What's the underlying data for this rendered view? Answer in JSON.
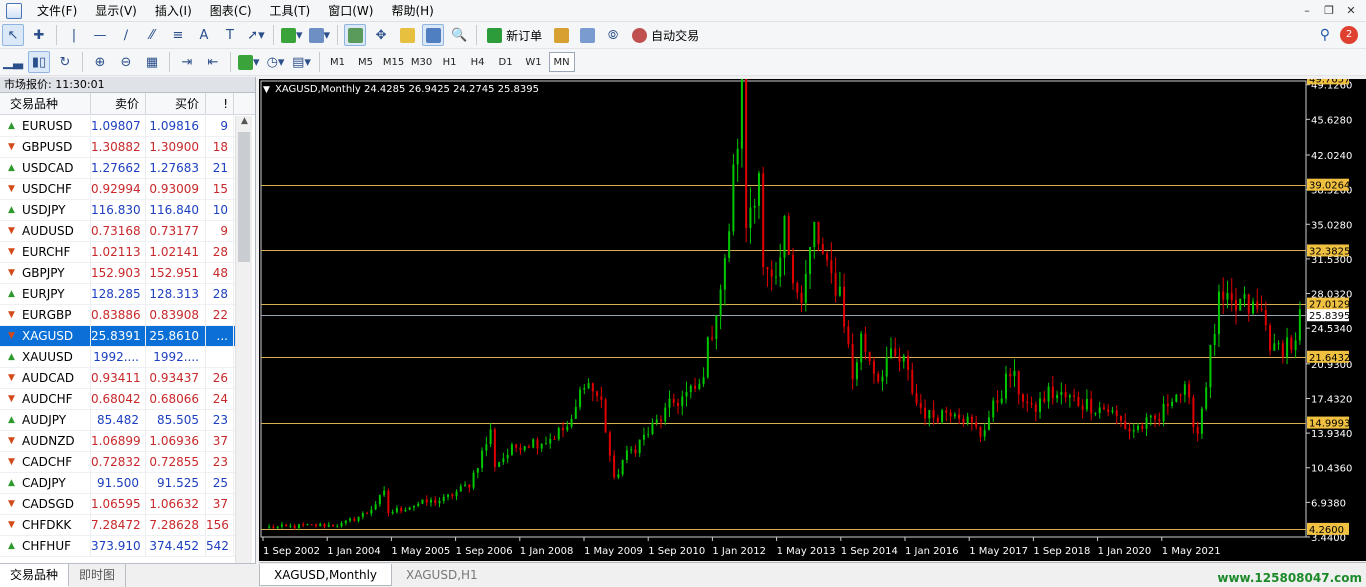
{
  "menu": [
    "文件(F)",
    "显示(V)",
    "插入(I)",
    "图表(C)",
    "工具(T)",
    "窗口(W)",
    "帮助(H)"
  ],
  "toolbar": {
    "new_order_label": "新订单",
    "auto_trade_label": "自动交易",
    "notification_count": "2"
  },
  "timeframes": [
    "M1",
    "M5",
    "M15",
    "M30",
    "H1",
    "H4",
    "D1",
    "W1",
    "MN"
  ],
  "active_timeframe": "MN",
  "market_watch": {
    "title": "市场报价: 11:30:01",
    "columns": {
      "symbol": "交易品种",
      "bid": "卖价",
      "ask": "买价",
      "spread": "!"
    },
    "rows": [
      {
        "symbol": "EURUSD",
        "bid": "1.09807",
        "ask": "1.09816",
        "spread": "9",
        "dir": "up"
      },
      {
        "symbol": "GBPUSD",
        "bid": "1.30882",
        "ask": "1.30900",
        "spread": "18",
        "dir": "down"
      },
      {
        "symbol": "USDCAD",
        "bid": "1.27662",
        "ask": "1.27683",
        "spread": "21",
        "dir": "up"
      },
      {
        "symbol": "USDCHF",
        "bid": "0.92994",
        "ask": "0.93009",
        "spread": "15",
        "dir": "down"
      },
      {
        "symbol": "USDJPY",
        "bid": "116.830",
        "ask": "116.840",
        "spread": "10",
        "dir": "up"
      },
      {
        "symbol": "AUDUSD",
        "bid": "0.73168",
        "ask": "0.73177",
        "spread": "9",
        "dir": "down"
      },
      {
        "symbol": "EURCHF",
        "bid": "1.02113",
        "ask": "1.02141",
        "spread": "28",
        "dir": "down"
      },
      {
        "symbol": "GBPJPY",
        "bid": "152.903",
        "ask": "152.951",
        "spread": "48",
        "dir": "down"
      },
      {
        "symbol": "EURJPY",
        "bid": "128.285",
        "ask": "128.313",
        "spread": "28",
        "dir": "up"
      },
      {
        "symbol": "EURGBP",
        "bid": "0.83886",
        "ask": "0.83908",
        "spread": "22",
        "dir": "down"
      },
      {
        "symbol": "XAGUSD",
        "bid": "25.8391",
        "ask": "25.8610",
        "spread": "...",
        "dir": "down",
        "selected": true
      },
      {
        "symbol": "XAUUSD",
        "bid": "1992....",
        "ask": "1992....",
        "spread": "",
        "dir": "up"
      },
      {
        "symbol": "AUDCAD",
        "bid": "0.93411",
        "ask": "0.93437",
        "spread": "26",
        "dir": "down"
      },
      {
        "symbol": "AUDCHF",
        "bid": "0.68042",
        "ask": "0.68066",
        "spread": "24",
        "dir": "down"
      },
      {
        "symbol": "AUDJPY",
        "bid": "85.482",
        "ask": "85.505",
        "spread": "23",
        "dir": "up"
      },
      {
        "symbol": "AUDNZD",
        "bid": "1.06899",
        "ask": "1.06936",
        "spread": "37",
        "dir": "down"
      },
      {
        "symbol": "CADCHF",
        "bid": "0.72832",
        "ask": "0.72855",
        "spread": "23",
        "dir": "down"
      },
      {
        "symbol": "CADJPY",
        "bid": "91.500",
        "ask": "91.525",
        "spread": "25",
        "dir": "up"
      },
      {
        "symbol": "CADSGD",
        "bid": "1.06595",
        "ask": "1.06632",
        "spread": "37",
        "dir": "down"
      },
      {
        "symbol": "CHFDKK",
        "bid": "7.28472",
        "ask": "7.28628",
        "spread": "156",
        "dir": "down"
      },
      {
        "symbol": "CHFHUF",
        "bid": "373.910",
        "ask": "374.452",
        "spread": "542",
        "dir": "up"
      }
    ],
    "tabs": [
      "交易品种",
      "即时图"
    ]
  },
  "chart_tabs": [
    "XAGUSD,Monthly",
    "XAGUSD,H1"
  ],
  "watermark": "www.125808047.com",
  "colors": {
    "bull": "#00c800",
    "bear": "#e00000",
    "level_line": "#d8b050",
    "price_line": "#9aa3b8",
    "chart_bg": "#000000",
    "axis_text": "#ffffff",
    "level_label_bg": "#f0c040"
  },
  "chart_data": {
    "type": "candlestick",
    "title": "XAGUSD,Monthly 24.4285 26.9425 24.2745 25.8395",
    "ylim": [
      3.44,
      49.5
    ],
    "yticks": [
      49.126,
      45.628,
      42.024,
      38.526,
      35.028,
      31.53,
      28.032,
      24.534,
      20.93,
      17.432,
      13.934,
      10.436,
      6.938,
      3.44
    ],
    "xtick_labels": [
      "1 Sep 2002",
      "1 Jan 2004",
      "1 May 2005",
      "1 Sep 2006",
      "1 Jan 2008",
      "1 May 2009",
      "1 Sep 2010",
      "1 Jan 2012",
      "1 May 2013",
      "1 Sep 2014",
      "1 Jan 2016",
      "1 May 2017",
      "1 Sep 2018",
      "1 Jan 2020",
      "1 May 2021"
    ],
    "x_start": "2002-01",
    "levels": [
      49.7657,
      39.0264,
      32.3825,
      27.0129,
      21.6432,
      14.9993,
      4.26
    ],
    "current_price": 25.8395,
    "anchors": [
      [
        "2002-01",
        4.4
      ],
      [
        "2002-12",
        4.6
      ],
      [
        "2003-06",
        4.7
      ],
      [
        "2003-12",
        5.9
      ],
      [
        "2004-04",
        7.8
      ],
      [
        "2004-05",
        5.9
      ],
      [
        "2004-12",
        6.8
      ],
      [
        "2005-06",
        7.2
      ],
      [
        "2005-12",
        8.8
      ],
      [
        "2006-05",
        14.0
      ],
      [
        "2006-06",
        10.8
      ],
      [
        "2006-12",
        12.9
      ],
      [
        "2007-06",
        13.2
      ],
      [
        "2007-12",
        14.8
      ],
      [
        "2008-03",
        19.5
      ],
      [
        "2008-07",
        17.0
      ],
      [
        "2008-10",
        9.0
      ],
      [
        "2008-12",
        11.2
      ],
      [
        "2009-06",
        14.0
      ],
      [
        "2009-12",
        17.0
      ],
      [
        "2010-06",
        18.5
      ],
      [
        "2010-12",
        30.6
      ],
      [
        "2011-04",
        48.4
      ],
      [
        "2011-05",
        35.0
      ],
      [
        "2011-08",
        41.0
      ],
      [
        "2011-09",
        30.0
      ],
      [
        "2011-12",
        28.2
      ],
      [
        "2012-02",
        34.5
      ],
      [
        "2012-06",
        27.0
      ],
      [
        "2012-09",
        34.6
      ],
      [
        "2012-12",
        30.0
      ],
      [
        "2013-03",
        28.5
      ],
      [
        "2013-06",
        19.5
      ],
      [
        "2013-08",
        23.5
      ],
      [
        "2013-12",
        19.5
      ],
      [
        "2014-02",
        21.5
      ],
      [
        "2014-06",
        21.0
      ],
      [
        "2014-09",
        17.0
      ],
      [
        "2014-12",
        15.6
      ],
      [
        "2015-06",
        16.5
      ],
      [
        "2015-12",
        13.8
      ],
      [
        "2016-07",
        20.0
      ],
      [
        "2016-12",
        16.0
      ],
      [
        "2017-04",
        18.0
      ],
      [
        "2017-12",
        17.0
      ],
      [
        "2018-06",
        16.3
      ],
      [
        "2018-11",
        14.2
      ],
      [
        "2019-06",
        15.3
      ],
      [
        "2019-09",
        18.0
      ],
      [
        "2019-12",
        18.0
      ],
      [
        "2020-03",
        14.0
      ],
      [
        "2020-07",
        24.5
      ],
      [
        "2020-08",
        26.9
      ],
      [
        "2020-12",
        26.4
      ],
      [
        "2021-01",
        27.0
      ],
      [
        "2021-06",
        26.0
      ],
      [
        "2021-09",
        22.0
      ],
      [
        "2021-12",
        23.2
      ],
      [
        "2022-02",
        22.5
      ],
      [
        "2022-03",
        25.8
      ]
    ]
  }
}
